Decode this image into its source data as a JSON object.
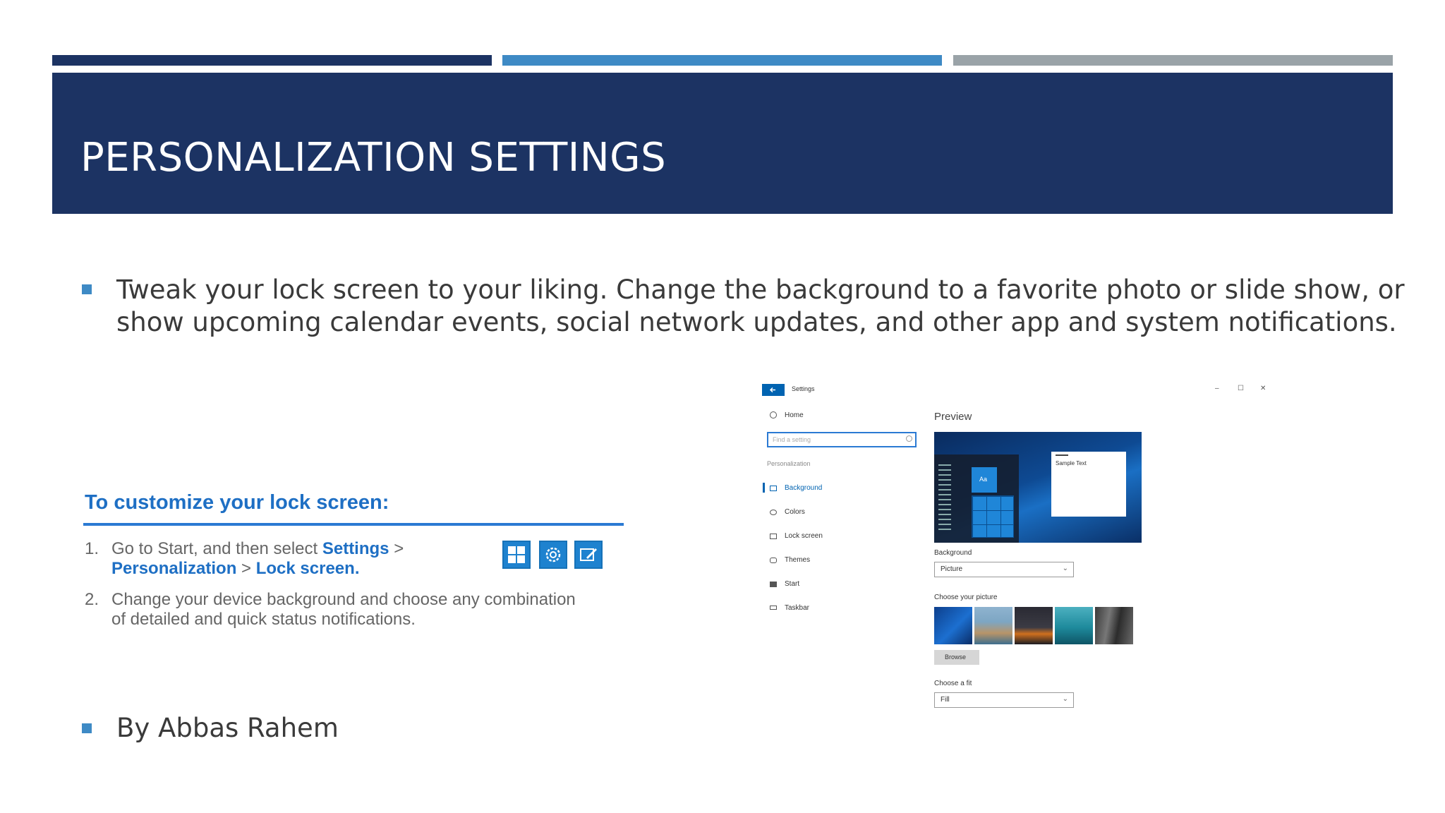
{
  "slide": {
    "title": "PERSONALIZATION SETTINGS",
    "colors": {
      "dark_navy": "#1c3363",
      "blue": "#3e8ac5",
      "gray": "#9aa3a8"
    },
    "bullets": [
      {
        "line1": "Tweak your lock screen to your liking. Change the background to a favorite photo or slide show, or",
        "line2": "show upcoming calendar events, social network updates, and other app and system notifications."
      },
      {
        "line1": "By Abbas Rahem"
      }
    ]
  },
  "howto": {
    "title": "To customize your lock screen:",
    "steps": [
      {
        "num": "1.",
        "pre": "Go to Start, and then select ",
        "settings": "Settings",
        "sep1": " >",
        "personalization": "Personalization",
        "sep2": " > ",
        "lock_screen": "Lock screen",
        "end": "."
      },
      {
        "num": "2.",
        "line1": "Change your device background and choose any combination",
        "line2": "of detailed and quick status notifications."
      }
    ],
    "icons": [
      "windows-logo-icon",
      "gear-icon",
      "personalization-pen-icon"
    ]
  },
  "settings_window": {
    "app_title": "Settings",
    "window_controls": {
      "minimize": "–",
      "maximize": "☐",
      "close": "✕"
    },
    "home": "Home",
    "search_placeholder": "Find a setting",
    "section": "Personalization",
    "nav": [
      "Background",
      "Colors",
      "Lock screen",
      "Themes",
      "Start",
      "Taskbar"
    ],
    "active_nav": "Background",
    "preview_label": "Preview",
    "preview_tile_text": "Aa",
    "preview_sample_text": "Sample Text",
    "background_label": "Background",
    "background_value": "Picture",
    "choose_picture_label": "Choose your picture",
    "browse_label": "Browse",
    "choose_fit_label": "Choose a fit",
    "fit_value": "Fill",
    "accent_color": "#0063b1"
  }
}
